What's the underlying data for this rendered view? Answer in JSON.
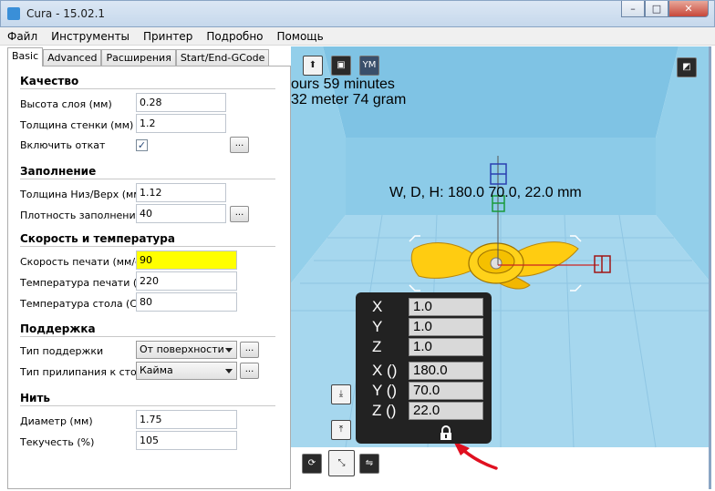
{
  "window": {
    "title": "Cura - 15.02.1",
    "min": "–",
    "max": "□",
    "close": "✕"
  },
  "menu": [
    "Файл",
    "Инструменты",
    "Принтер",
    "Подробно",
    "Помощь"
  ],
  "tabs": [
    "Basic",
    "Advanced",
    "Расширения",
    "Start/End-GCode"
  ],
  "sections": {
    "quality": "Качество",
    "fill": "Заполнение",
    "speed": "Скорость и температура",
    "support": "Поддержка",
    "filament": "Нить"
  },
  "fields": {
    "layer_height": {
      "label": "Высота слоя (мм)",
      "value": "0.28"
    },
    "wall_thickness": {
      "label": "Толщина стенки (мм)",
      "value": "1.2"
    },
    "retraction": {
      "label": "Включить откат",
      "checked": "✓"
    },
    "bottom_top": {
      "label": "Толщина Низ/Верх (мм)",
      "value": "1.12"
    },
    "fill_density": {
      "label": "Плотность заполнения",
      "value": "40"
    },
    "print_speed": {
      "label": "Скорость печати (мм/с)",
      "value": "90"
    },
    "print_temp": {
      "label": "Температура печати (С)",
      "value": "220"
    },
    "bed_temp": {
      "label": "Температура стола (С)",
      "value": "80"
    },
    "support_type": {
      "label": "Тип поддержки",
      "value": "От поверхности"
    },
    "adhesion": {
      "label": "Тип прилипания к столу",
      "value": "Кайма"
    },
    "diameter": {
      "label": "Диаметр (мм)",
      "value": "1.75"
    },
    "flow": {
      "label": "Текучесть (%)",
      "value": "105"
    }
  },
  "dots_label": "...",
  "viewport": {
    "time_text": "ours 59 minutes",
    "material_text": "32 meter 74 gram",
    "dims_text": "W, D, H: 180.0  70.0, 22.0 mm",
    "tool_ym": "YM",
    "scale": {
      "x_label": "X",
      "y_label": "Y",
      "z_label": "Z",
      "x": "1.0",
      "y": "1.0",
      "z": "1.0",
      "sx_label": "X ()",
      "sy_label": "Y ()",
      "sz_label": "Z ()",
      "size_x": "180.0",
      "size_y": "70.0",
      "size_z": "22.0"
    },
    "colors": {
      "volume": "#7fc3e4",
      "model": "#ffcc11",
      "panel": "#222222",
      "arrow": "#e01020"
    }
  }
}
